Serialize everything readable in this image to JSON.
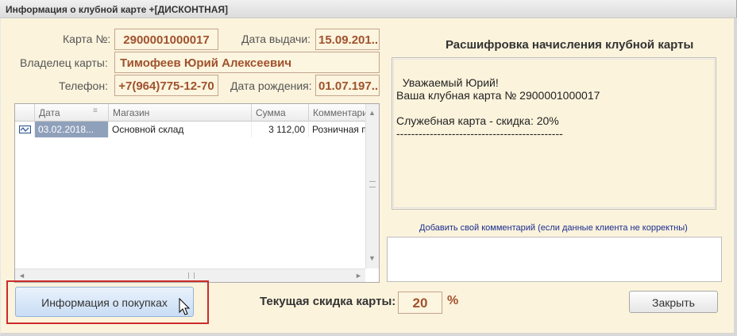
{
  "window": {
    "title": "Информация о клубной карте +[ДИСКОНТНАЯ]"
  },
  "card": {
    "number_label": "Карта №:",
    "number": "2900001000017",
    "issue_date_label": "Дата выдачи:",
    "issue_date": "15.09.201...",
    "owner_label": "Владелец карты:",
    "owner": "Тимофеев Юрий Алексеевич",
    "phone_label": "Телефон:",
    "phone": "+7(964)775-12-70",
    "birth_date_label": "Дата рождения:",
    "birth_date": "01.07.197..."
  },
  "table": {
    "columns": [
      "Дата",
      "Магазин",
      "Сумма",
      "Комментарий"
    ],
    "rows": [
      {
        "date": "03.02.2018...",
        "store": "Основной склад",
        "sum": "3 112,00",
        "comment": "Розничная прода"
      }
    ]
  },
  "decoding": {
    "title": "Расшифровка начисления клубной карты",
    "text": "Уважаемый Юрий!\nВаша клубная карта № 2900001000017\n\nСлужебная карта - скидка: 20%\n---------------------------------------------"
  },
  "comment": {
    "hint": "Добавить свой комментарий (если данные клиента не корректны)",
    "value": ""
  },
  "footer": {
    "info_button": "Информация о покупках",
    "discount_label": "Текущая скидка карты:",
    "discount_value": "20",
    "percent_sign": "%",
    "close_button": "Закрыть"
  },
  "colors": {
    "accent_value": "#a0522d",
    "highlight": "#cc2b2b",
    "background": "#fbf3dc"
  }
}
